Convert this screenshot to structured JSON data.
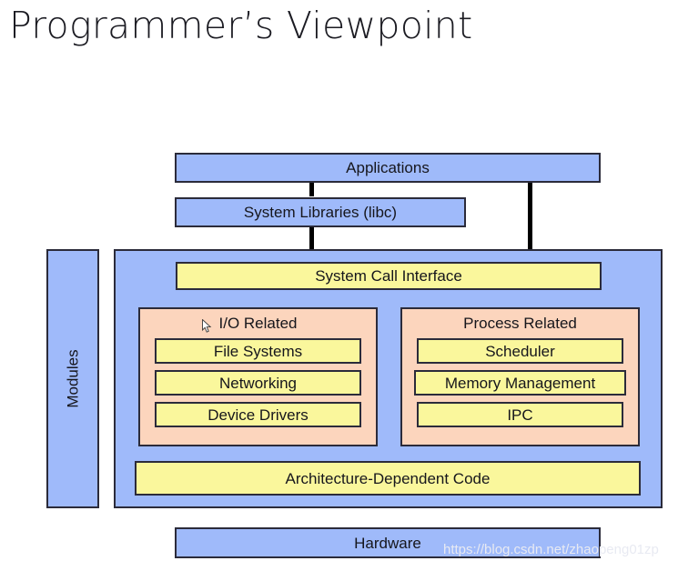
{
  "slide": {
    "title": "Programmer’s Viewpoint",
    "watermark": "https://blog.csdn.net/zhaopeng01zp"
  },
  "palette": {
    "blue": "#9fbafa",
    "yellow": "#faf79c",
    "pink": "#fcd5bd",
    "border": "#2b2b3a",
    "connector": "#000000",
    "title_text": "#1b1b22",
    "watermark_text": "#e8eaf2"
  },
  "diagram": {
    "type": "layered-block-diagram",
    "user_space": {
      "applications": {
        "label": "Applications"
      },
      "system_libraries": {
        "label": "System Libraries (libc)"
      }
    },
    "modules_panel": {
      "label": "Modules",
      "orientation": "vertical"
    },
    "kernel": {
      "system_call_interface": {
        "label": "System Call Interface"
      },
      "groups": [
        {
          "label": "I/O Related",
          "items": [
            {
              "label": "File Systems"
            },
            {
              "label": "Networking"
            },
            {
              "label": "Device Drivers"
            }
          ]
        },
        {
          "label": "Process Related",
          "items": [
            {
              "label": "Scheduler"
            },
            {
              "label": "Memory Management"
            },
            {
              "label": "IPC"
            }
          ]
        }
      ],
      "architecture_dependent_code": {
        "label": "Architecture-Dependent Code"
      }
    },
    "hardware": {
      "label": "Hardware"
    }
  }
}
